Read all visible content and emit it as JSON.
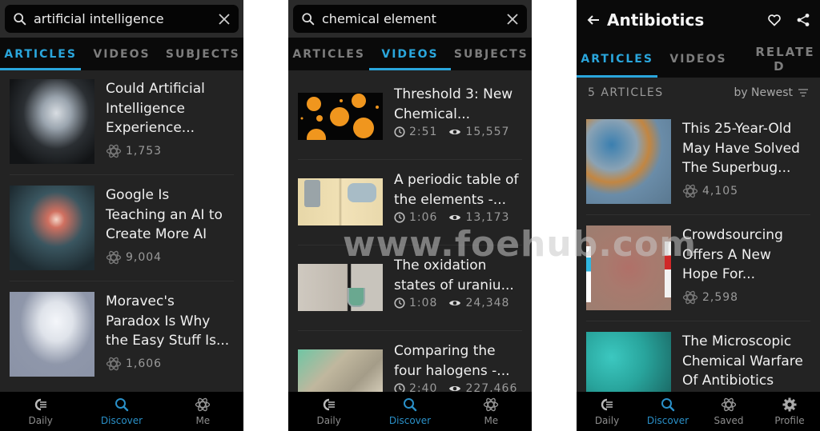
{
  "colors": {
    "accent": "#2aa6dc",
    "background": "#232323",
    "header": "#0a0a0a",
    "nav": "#000000"
  },
  "screens": [
    {
      "search": {
        "query": "artificial intelligence",
        "search_icon": "search-icon",
        "clear_icon": "close-icon"
      },
      "tabs": [
        {
          "label": "ARTICLES",
          "active": true
        },
        {
          "label": "VIDEOS",
          "active": false
        },
        {
          "label": "SUBJECTS",
          "active": false
        }
      ],
      "articles": [
        {
          "title_lines": [
            "Could Artificial",
            "Intelligence",
            "Experience..."
          ],
          "count": "1,753",
          "thumb": "robot-head-down"
        },
        {
          "title_lines": [
            "Google Is",
            "Teaching an AI to",
            "Create More AI"
          ],
          "count": "9,004",
          "thumb": "neural-network"
        },
        {
          "title_lines": [
            "Moravec's",
            "Paradox Is Why",
            "the Easy Stuff Is..."
          ],
          "count": "1,606",
          "thumb": "robot-thinking"
        }
      ],
      "nav": [
        {
          "label": "Daily",
          "icon": "daily-icon",
          "active": false
        },
        {
          "label": "Discover",
          "icon": "search-icon",
          "active": true
        },
        {
          "label": "Me",
          "icon": "atom-icon",
          "active": false
        }
      ]
    },
    {
      "search": {
        "query": "chemical element",
        "search_icon": "search-icon",
        "clear_icon": "close-icon"
      },
      "tabs": [
        {
          "label": "ARTICLES",
          "active": false
        },
        {
          "label": "VIDEOS",
          "active": true
        },
        {
          "label": "SUBJECTS",
          "active": false
        }
      ],
      "videos": [
        {
          "title_lines": [
            "Threshold 3: New",
            "Chemical..."
          ],
          "duration": "2:51",
          "views": "15,557",
          "thumb": "orange-circles"
        },
        {
          "title_lines": [
            "A periodic table of",
            "the elements -..."
          ],
          "duration": "1:06",
          "views": "13,173",
          "thumb": "element-samples"
        },
        {
          "title_lines": [
            "The oxidation",
            "states of uraniu..."
          ],
          "duration": "1:08",
          "views": "24,348",
          "thumb": "lab-glassware"
        },
        {
          "title_lines": [
            "Comparing the",
            "four halogens -..."
          ],
          "duration": "2:40",
          "views": "227,466",
          "thumb": "gloved-hands"
        }
      ],
      "nav": [
        {
          "label": "Daily",
          "icon": "daily-icon",
          "active": false
        },
        {
          "label": "Discover",
          "icon": "search-icon",
          "active": true
        },
        {
          "label": "Me",
          "icon": "atom-icon",
          "active": false
        }
      ]
    },
    {
      "header": {
        "title": "Antibiotics",
        "back_icon": "arrow-left-icon",
        "favorite_icon": "heart-icon",
        "share_icon": "share-icon"
      },
      "tabs": [
        {
          "label": "ARTICLES",
          "active": true
        },
        {
          "label": "VIDEOS",
          "active": false
        },
        {
          "label": "RELATE D",
          "active": false
        }
      ],
      "subbar": {
        "count": "5 ARTICLES",
        "sort": "by Newest",
        "sort_icon": "sort-icon"
      },
      "articles": [
        {
          "title_lines": [
            "This 25-Year-Old",
            "May Have Solved",
            "The Superbug..."
          ],
          "count": "4,105",
          "thumb": "bacteria"
        },
        {
          "title_lines": [
            "Crowdsourcing",
            "Offers A New",
            "Hope For..."
          ],
          "count": "2,598",
          "thumb": "pills-face"
        },
        {
          "title_lines": [
            "The Microscopic",
            "Chemical Warfare",
            "Of Antibiotics"
          ],
          "count": "",
          "thumb": "divers"
        }
      ],
      "nav": [
        {
          "label": "Daily",
          "icon": "daily-icon",
          "active": false
        },
        {
          "label": "Discover",
          "icon": "search-icon",
          "active": true
        },
        {
          "label": "Saved",
          "icon": "atom-icon",
          "active": false
        },
        {
          "label": "Profile",
          "icon": "gear-icon",
          "active": false
        }
      ]
    }
  ],
  "watermark": "www.foehub.com"
}
